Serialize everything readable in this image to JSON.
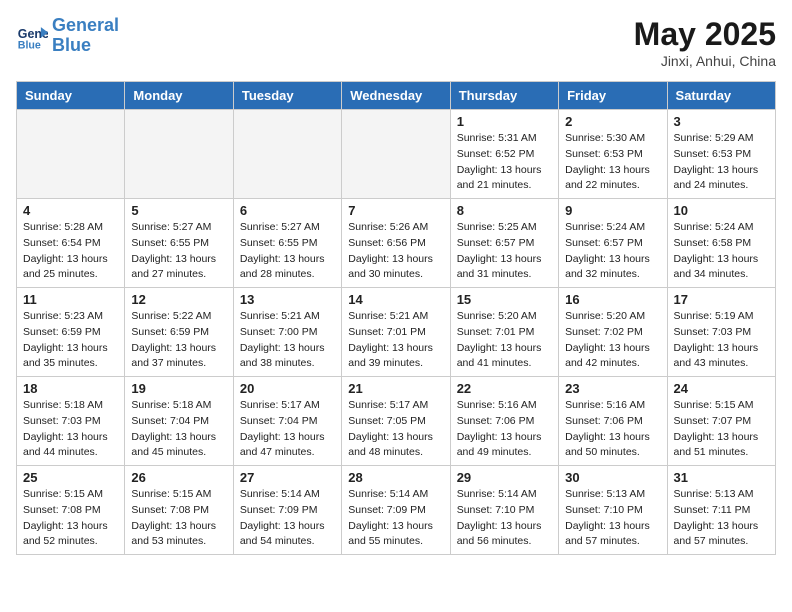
{
  "header": {
    "logo_line1": "General",
    "logo_line2": "Blue",
    "month": "May 2025",
    "location": "Jinxi, Anhui, China"
  },
  "weekdays": [
    "Sunday",
    "Monday",
    "Tuesday",
    "Wednesday",
    "Thursday",
    "Friday",
    "Saturday"
  ],
  "weeks": [
    [
      {
        "day": "",
        "empty": true
      },
      {
        "day": "",
        "empty": true
      },
      {
        "day": "",
        "empty": true
      },
      {
        "day": "",
        "empty": true
      },
      {
        "day": "1",
        "sunrise": "5:31 AM",
        "sunset": "6:52 PM",
        "daylight": "13 hours and 21 minutes."
      },
      {
        "day": "2",
        "sunrise": "5:30 AM",
        "sunset": "6:53 PM",
        "daylight": "13 hours and 22 minutes."
      },
      {
        "day": "3",
        "sunrise": "5:29 AM",
        "sunset": "6:53 PM",
        "daylight": "13 hours and 24 minutes."
      }
    ],
    [
      {
        "day": "4",
        "sunrise": "5:28 AM",
        "sunset": "6:54 PM",
        "daylight": "13 hours and 25 minutes."
      },
      {
        "day": "5",
        "sunrise": "5:27 AM",
        "sunset": "6:55 PM",
        "daylight": "13 hours and 27 minutes."
      },
      {
        "day": "6",
        "sunrise": "5:27 AM",
        "sunset": "6:55 PM",
        "daylight": "13 hours and 28 minutes."
      },
      {
        "day": "7",
        "sunrise": "5:26 AM",
        "sunset": "6:56 PM",
        "daylight": "13 hours and 30 minutes."
      },
      {
        "day": "8",
        "sunrise": "5:25 AM",
        "sunset": "6:57 PM",
        "daylight": "13 hours and 31 minutes."
      },
      {
        "day": "9",
        "sunrise": "5:24 AM",
        "sunset": "6:57 PM",
        "daylight": "13 hours and 32 minutes."
      },
      {
        "day": "10",
        "sunrise": "5:24 AM",
        "sunset": "6:58 PM",
        "daylight": "13 hours and 34 minutes."
      }
    ],
    [
      {
        "day": "11",
        "sunrise": "5:23 AM",
        "sunset": "6:59 PM",
        "daylight": "13 hours and 35 minutes."
      },
      {
        "day": "12",
        "sunrise": "5:22 AM",
        "sunset": "6:59 PM",
        "daylight": "13 hours and 37 minutes."
      },
      {
        "day": "13",
        "sunrise": "5:21 AM",
        "sunset": "7:00 PM",
        "daylight": "13 hours and 38 minutes."
      },
      {
        "day": "14",
        "sunrise": "5:21 AM",
        "sunset": "7:01 PM",
        "daylight": "13 hours and 39 minutes."
      },
      {
        "day": "15",
        "sunrise": "5:20 AM",
        "sunset": "7:01 PM",
        "daylight": "13 hours and 41 minutes."
      },
      {
        "day": "16",
        "sunrise": "5:20 AM",
        "sunset": "7:02 PM",
        "daylight": "13 hours and 42 minutes."
      },
      {
        "day": "17",
        "sunrise": "5:19 AM",
        "sunset": "7:03 PM",
        "daylight": "13 hours and 43 minutes."
      }
    ],
    [
      {
        "day": "18",
        "sunrise": "5:18 AM",
        "sunset": "7:03 PM",
        "daylight": "13 hours and 44 minutes."
      },
      {
        "day": "19",
        "sunrise": "5:18 AM",
        "sunset": "7:04 PM",
        "daylight": "13 hours and 45 minutes."
      },
      {
        "day": "20",
        "sunrise": "5:17 AM",
        "sunset": "7:04 PM",
        "daylight": "13 hours and 47 minutes."
      },
      {
        "day": "21",
        "sunrise": "5:17 AM",
        "sunset": "7:05 PM",
        "daylight": "13 hours and 48 minutes."
      },
      {
        "day": "22",
        "sunrise": "5:16 AM",
        "sunset": "7:06 PM",
        "daylight": "13 hours and 49 minutes."
      },
      {
        "day": "23",
        "sunrise": "5:16 AM",
        "sunset": "7:06 PM",
        "daylight": "13 hours and 50 minutes."
      },
      {
        "day": "24",
        "sunrise": "5:15 AM",
        "sunset": "7:07 PM",
        "daylight": "13 hours and 51 minutes."
      }
    ],
    [
      {
        "day": "25",
        "sunrise": "5:15 AM",
        "sunset": "7:08 PM",
        "daylight": "13 hours and 52 minutes."
      },
      {
        "day": "26",
        "sunrise": "5:15 AM",
        "sunset": "7:08 PM",
        "daylight": "13 hours and 53 minutes."
      },
      {
        "day": "27",
        "sunrise": "5:14 AM",
        "sunset": "7:09 PM",
        "daylight": "13 hours and 54 minutes."
      },
      {
        "day": "28",
        "sunrise": "5:14 AM",
        "sunset": "7:09 PM",
        "daylight": "13 hours and 55 minutes."
      },
      {
        "day": "29",
        "sunrise": "5:14 AM",
        "sunset": "7:10 PM",
        "daylight": "13 hours and 56 minutes."
      },
      {
        "day": "30",
        "sunrise": "5:13 AM",
        "sunset": "7:10 PM",
        "daylight": "13 hours and 57 minutes."
      },
      {
        "day": "31",
        "sunrise": "5:13 AM",
        "sunset": "7:11 PM",
        "daylight": "13 hours and 57 minutes."
      }
    ]
  ]
}
